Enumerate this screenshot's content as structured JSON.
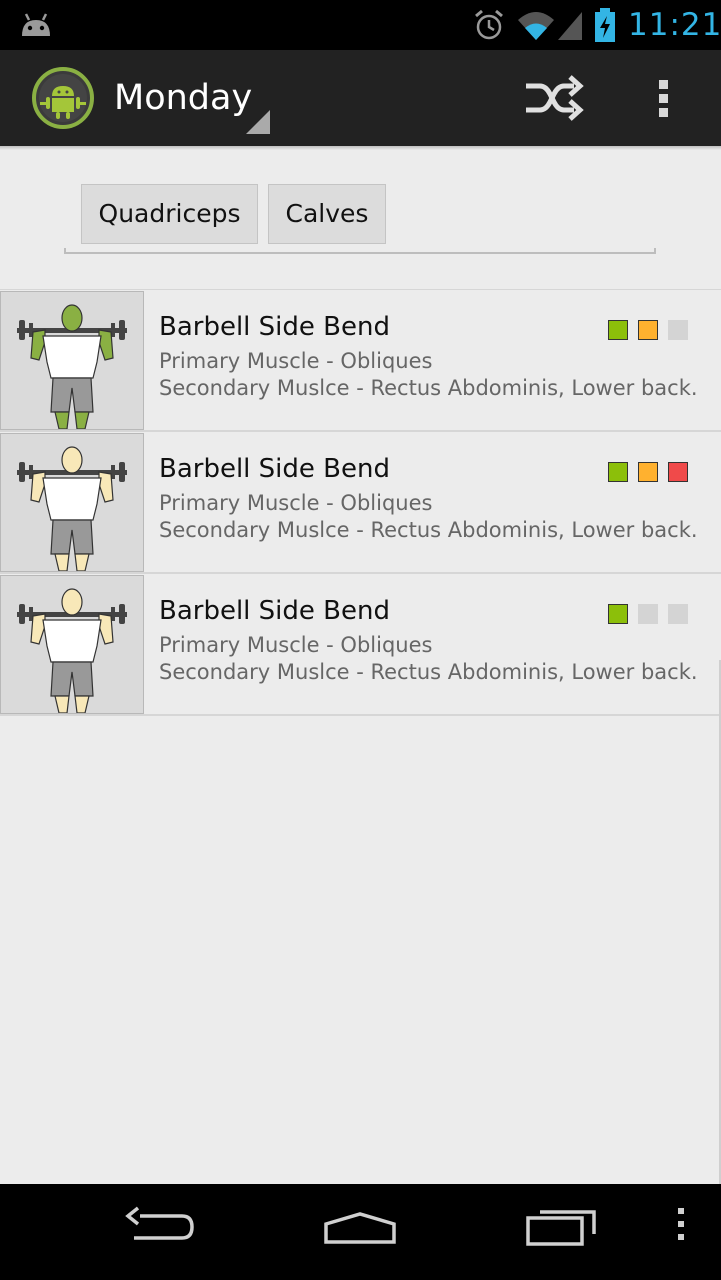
{
  "status_bar": {
    "time": "11:21",
    "clock_color": "#33b5e5"
  },
  "action_bar": {
    "day": "Monday",
    "icons": [
      "android-logo-icon",
      "shuffle-icon",
      "overflow-menu-icon"
    ]
  },
  "muscle_filters": [
    {
      "label": "Quadriceps"
    },
    {
      "label": "Calves"
    }
  ],
  "colors": {
    "green": "#8cbf0a",
    "orange": "#ffb12f",
    "red": "#f04a4a",
    "gray": "#d4d4d4",
    "highlight_green": "#8ab043"
  },
  "exercises": [
    {
      "title": "Barbell Side Bend",
      "primary": "Primary Muscle - Obliques",
      "secondary": "Secondary Muslce - Rectus Abdominis, Lower back.",
      "rating_colors": [
        "#8cbf0a",
        "#ffb12f",
        "#d4d4d4"
      ],
      "highlighted": true
    },
    {
      "title": "Barbell Side Bend",
      "primary": "Primary Muscle - Obliques",
      "secondary": "Secondary Muslce - Rectus Abdominis, Lower back.",
      "rating_colors": [
        "#8cbf0a",
        "#ffb12f",
        "#f04a4a"
      ],
      "highlighted": false
    },
    {
      "title": "Barbell Side Bend",
      "primary": "Primary Muscle - Obliques",
      "secondary": "Secondary Muslce - Rectus Abdominis, Lower back.",
      "rating_colors": [
        "#8cbf0a",
        "#d4d4d4",
        "#d4d4d4"
      ],
      "highlighted": false
    }
  ],
  "nav_bar": {
    "icons": [
      "back-icon",
      "home-icon",
      "recent-apps-icon",
      "menu-icon"
    ]
  }
}
